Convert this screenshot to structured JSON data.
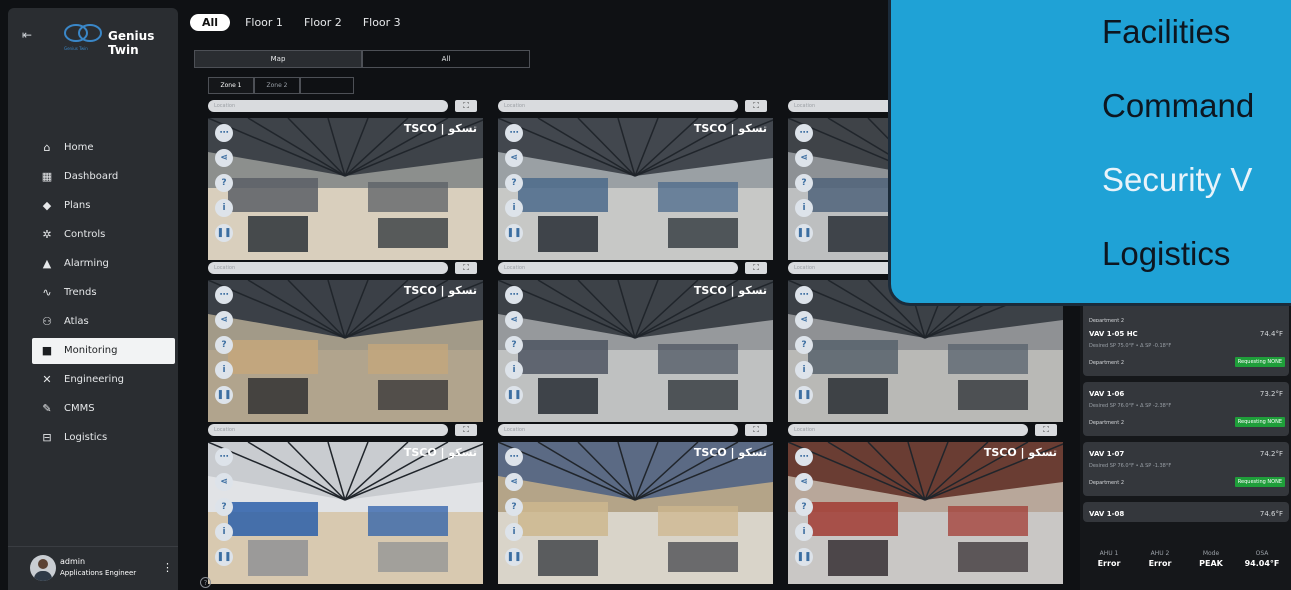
{
  "sidebar": {
    "collapse_icon": "collapse-icon",
    "brand": "Genius Twin",
    "tagline": "Genius Twin",
    "nav": [
      {
        "label": "Home",
        "icon": "home-icon",
        "glyph": "⌂",
        "active": false
      },
      {
        "label": "Dashboard",
        "icon": "dashboard-icon",
        "glyph": "▦",
        "active": false
      },
      {
        "label": "Plans",
        "icon": "layers-icon",
        "glyph": "◆",
        "active": false
      },
      {
        "label": "Controls",
        "icon": "gears-icon",
        "glyph": "✲",
        "active": false
      },
      {
        "label": "Alarming",
        "icon": "bell-icon",
        "glyph": "▲",
        "active": false
      },
      {
        "label": "Trends",
        "icon": "trend-icon",
        "glyph": "∿",
        "active": false
      },
      {
        "label": "Atlas",
        "icon": "people-icon",
        "glyph": "⚇",
        "active": false
      },
      {
        "label": "Monitoring",
        "icon": "video-icon",
        "glyph": "■",
        "active": true
      },
      {
        "label": "Engineering",
        "icon": "tools-icon",
        "glyph": "✕",
        "active": false
      },
      {
        "label": "CMMS",
        "icon": "wrench-icon",
        "glyph": "✎",
        "active": false
      },
      {
        "label": "Logistics",
        "icon": "car-icon",
        "glyph": "⊟",
        "active": false
      }
    ],
    "user": {
      "name": "admin",
      "role": "Applications Engineer"
    }
  },
  "floor_tabs": [
    {
      "label": "All",
      "active": true
    },
    {
      "label": "Floor 1",
      "active": false
    },
    {
      "label": "Floor 2",
      "active": false
    },
    {
      "label": "Floor 3",
      "active": false
    }
  ],
  "view_tabs": [
    {
      "label": "Map",
      "active": true
    },
    {
      "label": "All",
      "active": false
    }
  ],
  "zone_tabs": [
    {
      "label": "Zone 1",
      "active": true
    },
    {
      "label": "Zone 2",
      "active": false
    }
  ],
  "cameras": [
    {
      "header": "Location",
      "scene": "a"
    },
    {
      "header": "Location",
      "scene": "b"
    },
    {
      "header": "Location",
      "scene": "c"
    },
    {
      "header": "Location",
      "scene": "d"
    },
    {
      "header": "Location",
      "scene": "e"
    },
    {
      "header": "Location",
      "scene": "f"
    },
    {
      "header": "Location",
      "scene": "g"
    },
    {
      "header": "Location",
      "scene": "h"
    },
    {
      "header": "Location",
      "scene": "i"
    }
  ],
  "camera_brand": "TSCO | تسکو",
  "vav_units": [
    {
      "name": "",
      "temp": "",
      "sp": "",
      "dept": "Department 2",
      "status": ""
    },
    {
      "name": "VAV 1-05 HC",
      "temp": "74.4°F",
      "sp": "Desired SP  75.0°F  •  Δ SP  -0.18°F",
      "dept": "Department 2",
      "status": "Requesting NONE"
    },
    {
      "name": "VAV 1-06",
      "temp": "73.2°F",
      "sp": "Desired SP  76.0°F  •  Δ SP  -2.38°F",
      "dept": "Department 2",
      "status": "Requesting NONE"
    },
    {
      "name": "VAV 1-07",
      "temp": "74.2°F",
      "sp": "Desired SP  76.0°F  •  Δ SP  -1.38°F",
      "dept": "Department 2",
      "status": "Requesting NONE"
    },
    {
      "name": "VAV 1-08",
      "temp": "74.6°F",
      "sp": "",
      "dept": "",
      "status": ""
    }
  ],
  "readouts": [
    {
      "label": "AHU 1",
      "value": "Error"
    },
    {
      "label": "AHU 2",
      "value": "Error"
    },
    {
      "label": "Mode",
      "value": "PEAK"
    },
    {
      "label": "OSA",
      "value": "94.04°F"
    }
  ],
  "callout": {
    "items": [
      "Facilities",
      "Command",
      "Security V",
      "Logistics"
    ]
  },
  "colors": {
    "accent": "#1fa2d6",
    "status_ok": "#1f9e3a",
    "sidebar_bg": "#2a2d31"
  }
}
